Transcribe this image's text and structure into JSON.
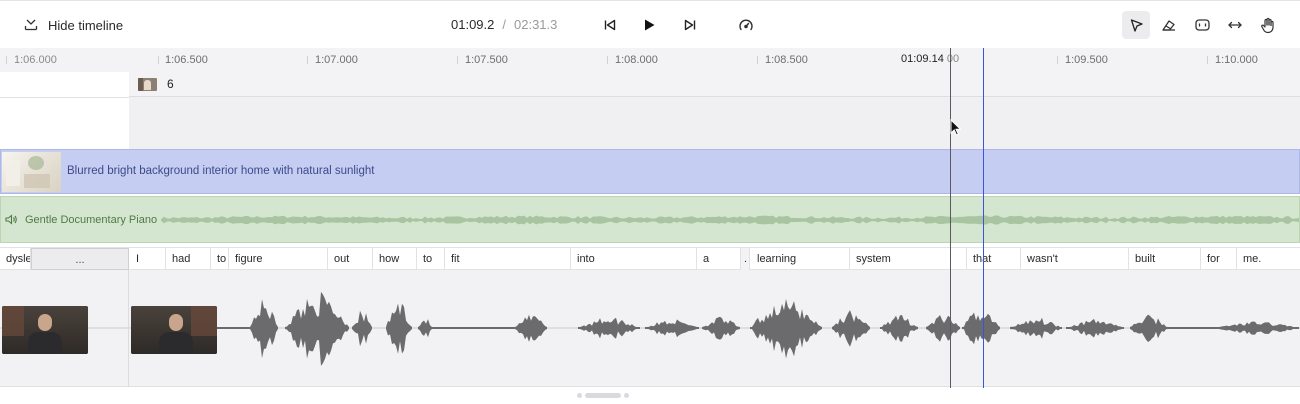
{
  "toolbar": {
    "hide_timeline_label": "Hide timeline",
    "current_time": "01:09.2",
    "separator": "/",
    "total_time": "02:31.3"
  },
  "ruler": {
    "labels": [
      "1:06.000",
      "1:06.500",
      "1:07.000",
      "1:07.500",
      "1:08.000",
      "1:08.500",
      "1:09.500",
      "1:10.000"
    ],
    "playhead_time": "01:09.14",
    "playhead_time_tail": "00"
  },
  "scene": {
    "number": "6"
  },
  "image_track": {
    "label": "Blurred bright background interior home with natural sunlight"
  },
  "audio_track": {
    "label": "Gentle Documentary Piano"
  },
  "words": {
    "w0": "dysle",
    "w1": "...",
    "w2": "I",
    "w3": "had",
    "w4": "to",
    "w5": "figure",
    "w6": "out",
    "w7": "how",
    "w8": "to",
    "w9": "fit",
    "w10": "into",
    "w11": "a",
    "w12": ".",
    "w13": "learning",
    "w14": "system",
    "w15": "that",
    "w16": "wasn't",
    "w17": "built",
    "w18": "for",
    "w19": "me."
  },
  "colors": {
    "image_track": "#c5cdf2",
    "audio_track": "#d4e6cf",
    "playhead_blue": "#3a55d6",
    "playhead_dark": "#5a5a62"
  }
}
